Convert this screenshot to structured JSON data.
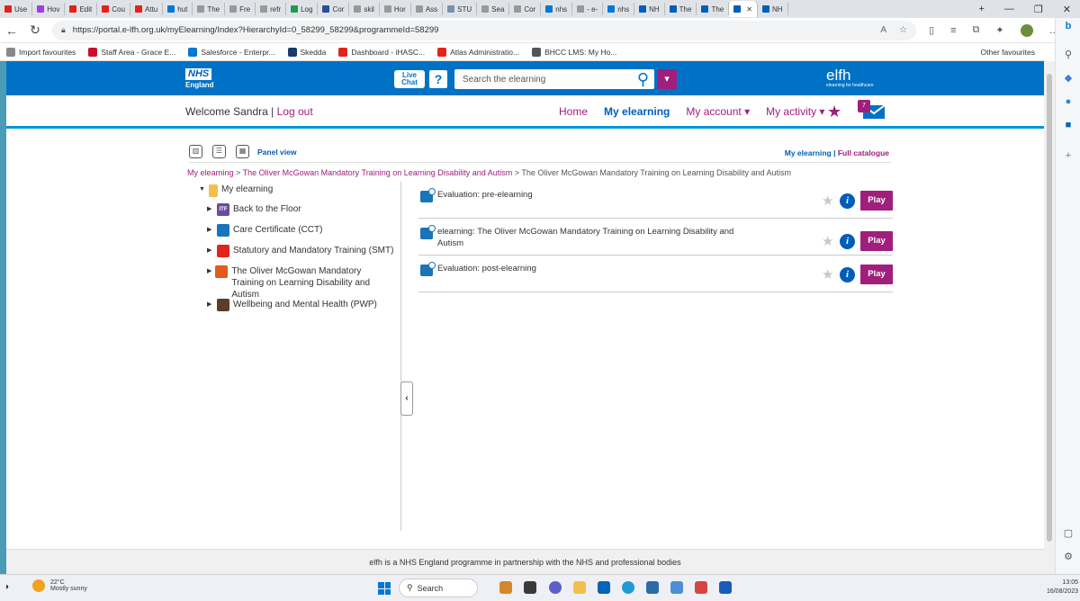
{
  "browser": {
    "tabs": [
      {
        "label": "Use",
        "color": "#e2231a"
      },
      {
        "label": "Hov",
        "color": "#9f3fe0"
      },
      {
        "label": "Edit",
        "color": "#e2231a"
      },
      {
        "label": "Cou",
        "color": "#e2231a"
      },
      {
        "label": "Attu",
        "color": "#e2231a"
      },
      {
        "label": "hut",
        "color": "#0078d4"
      },
      {
        "label": "The",
        "color": "#999999"
      },
      {
        "label": "Fre",
        "color": "#999999"
      },
      {
        "label": "refr",
        "color": "#999999"
      },
      {
        "label": "Log",
        "color": "#1e9b4e"
      },
      {
        "label": "Cor",
        "color": "#2a4e96"
      },
      {
        "label": "skil",
        "color": "#999999"
      },
      {
        "label": "Hor",
        "color": "#999999"
      },
      {
        "label": "Ass",
        "color": "#999999"
      },
      {
        "label": "STU",
        "color": "#7a8fb5"
      },
      {
        "label": "Sea",
        "color": "#999999"
      },
      {
        "label": "Cor",
        "color": "#999999"
      },
      {
        "label": "nhs",
        "color": "#0078d4"
      },
      {
        "label": "- e-",
        "color": "#999999"
      },
      {
        "label": "nhs",
        "color": "#0078d4"
      },
      {
        "label": "NH",
        "color": "#005eb8"
      },
      {
        "label": "The",
        "color": "#005eb8"
      },
      {
        "label": "The",
        "color": "#005eb8"
      },
      {
        "label": "",
        "color": "#005eb8"
      },
      {
        "label": "NH",
        "color": "#005eb8"
      }
    ],
    "url": "https://portal.e-lfh.org.uk/myElearning/Index?HierarchyId=0_58299_58299&programmeId=58299",
    "bookmarks": [
      {
        "label": "Import favourites",
        "color": "#888888"
      },
      {
        "label": "Staff Area - Grace E...",
        "color": "#c8102e"
      },
      {
        "label": "Salesforce - Enterpr...",
        "color": "#0078d4"
      },
      {
        "label": "Skedda",
        "color": "#1b3a6b"
      },
      {
        "label": "Dashboard - iHASC...",
        "color": "#e2231a"
      },
      {
        "label": "Atlas Administratio...",
        "color": "#e2231a"
      },
      {
        "label": "BHCC LMS: My Ho...",
        "color": "#555555"
      }
    ],
    "other_favourites": "Other favourites"
  },
  "header": {
    "nhs_logo": "NHS",
    "nhs_sub": "England",
    "live_chat": "Live Chat",
    "help": "?",
    "search_placeholder": "Search the elearning",
    "elfh_logo": "elfh",
    "elfh_tag": "elearning for healthcare"
  },
  "menu": {
    "welcome": "Welcome Sandra | ",
    "logout": "Log out",
    "items": [
      {
        "label": "Home",
        "current": false
      },
      {
        "label": "My elearning",
        "current": true
      },
      {
        "label": "My account ▾",
        "current": false
      },
      {
        "label": "My activity ▾",
        "current": false
      }
    ],
    "mail_badge": "7"
  },
  "view": {
    "panel_view": "Panel view",
    "my_elearning_link": "My elearning",
    "sep": " | ",
    "full_catalogue": "Full catalogue"
  },
  "breadcrumb": {
    "link1": "My elearning",
    "sep": " > ",
    "link2": "The Oliver McGowan Mandatory Training on Learning Disability and Autism",
    "current": "The Oliver McGowan Mandatory Training on Learning Disability and Autism"
  },
  "tree": {
    "root": "My elearning",
    "items": [
      {
        "label": "Back to the Floor",
        "icon_color": "#6a4c9c",
        "icon_text": "ITF"
      },
      {
        "label": "Care Certificate (CCT)",
        "icon_color": "#1a74b9",
        "icon_text": ""
      },
      {
        "label": "Statutory and Mandatory Training (SMT)",
        "icon_color": "#e2231a",
        "icon_text": ""
      },
      {
        "label": "The Oliver McGowan Mandatory Training on Learning Disability and Autism",
        "icon_color": "#e25a1c",
        "icon_text": ""
      },
      {
        "label": "Wellbeing and Mental Health (PWP)",
        "icon_color": "#5a3d2b",
        "icon_text": ""
      }
    ]
  },
  "content": {
    "rows": [
      {
        "title": "Evaluation: pre-elearning",
        "action": "Play"
      },
      {
        "title": "elearning: The Oliver McGowan Mandatory Training on Learning Disability and Autism",
        "action": "Play"
      },
      {
        "title": "Evaluation: post-elearning",
        "action": "Play"
      }
    ],
    "info_glyph": "i"
  },
  "footer": {
    "text": "elfh is a NHS England programme in partnership with the NHS and professional bodies"
  },
  "taskbar": {
    "temperature": "22°C",
    "weather": "Mostly sunny",
    "search": "Search",
    "time": "13:05",
    "date": "16/08/2023"
  },
  "colors": {
    "nhs_blue": "#0072c6",
    "accent_purple": "#a01e7c",
    "link_blue": "#005eb8"
  }
}
